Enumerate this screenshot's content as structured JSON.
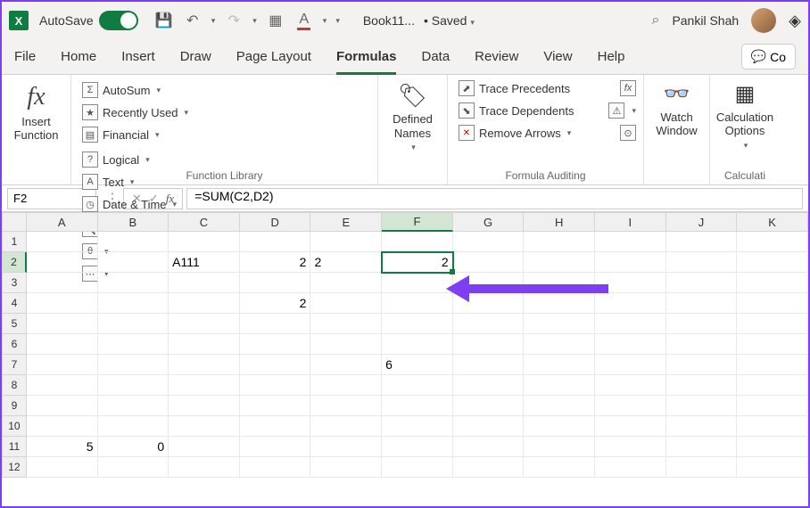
{
  "titlebar": {
    "autosave_label": "AutoSave",
    "doc_name": "Book11...",
    "saved_status": "Saved",
    "user": "Pankil Shah"
  },
  "tabs": [
    "File",
    "Home",
    "Insert",
    "Draw",
    "Page Layout",
    "Formulas",
    "Data",
    "Review",
    "View",
    "Help"
  ],
  "active_tab": "Formulas",
  "comments_label": "Co",
  "ribbon": {
    "insert_fn": "Insert Function",
    "autosum": "AutoSum",
    "recently": "Recently Used",
    "financial": "Financial",
    "logical": "Logical",
    "text": "Text",
    "datetime": "Date & Time",
    "defined_names": "Defined Names",
    "trace_prec": "Trace Precedents",
    "trace_dep": "Trace Dependents",
    "remove_arrows": "Remove Arrows",
    "watch": "Watch Window",
    "calc_opt": "Calculation Options",
    "group_fnlib": "Function Library",
    "group_audit": "Formula Auditing",
    "group_calc": "Calculati"
  },
  "namebox": "F2",
  "formula": "=SUM(C2,D2)",
  "columns": [
    "A",
    "B",
    "C",
    "D",
    "E",
    "F",
    "G",
    "H",
    "I",
    "J",
    "K"
  ],
  "rows": [
    "1",
    "2",
    "3",
    "4",
    "5",
    "6",
    "7",
    "8",
    "9",
    "10",
    "11",
    "12"
  ],
  "cells": {
    "C2": "A111",
    "D2": "2",
    "E2": "2",
    "F2": "2",
    "D4": "2",
    "F7": "6",
    "A11": "5",
    "B11": "0"
  },
  "active_cell": "F2",
  "chart_data": null
}
